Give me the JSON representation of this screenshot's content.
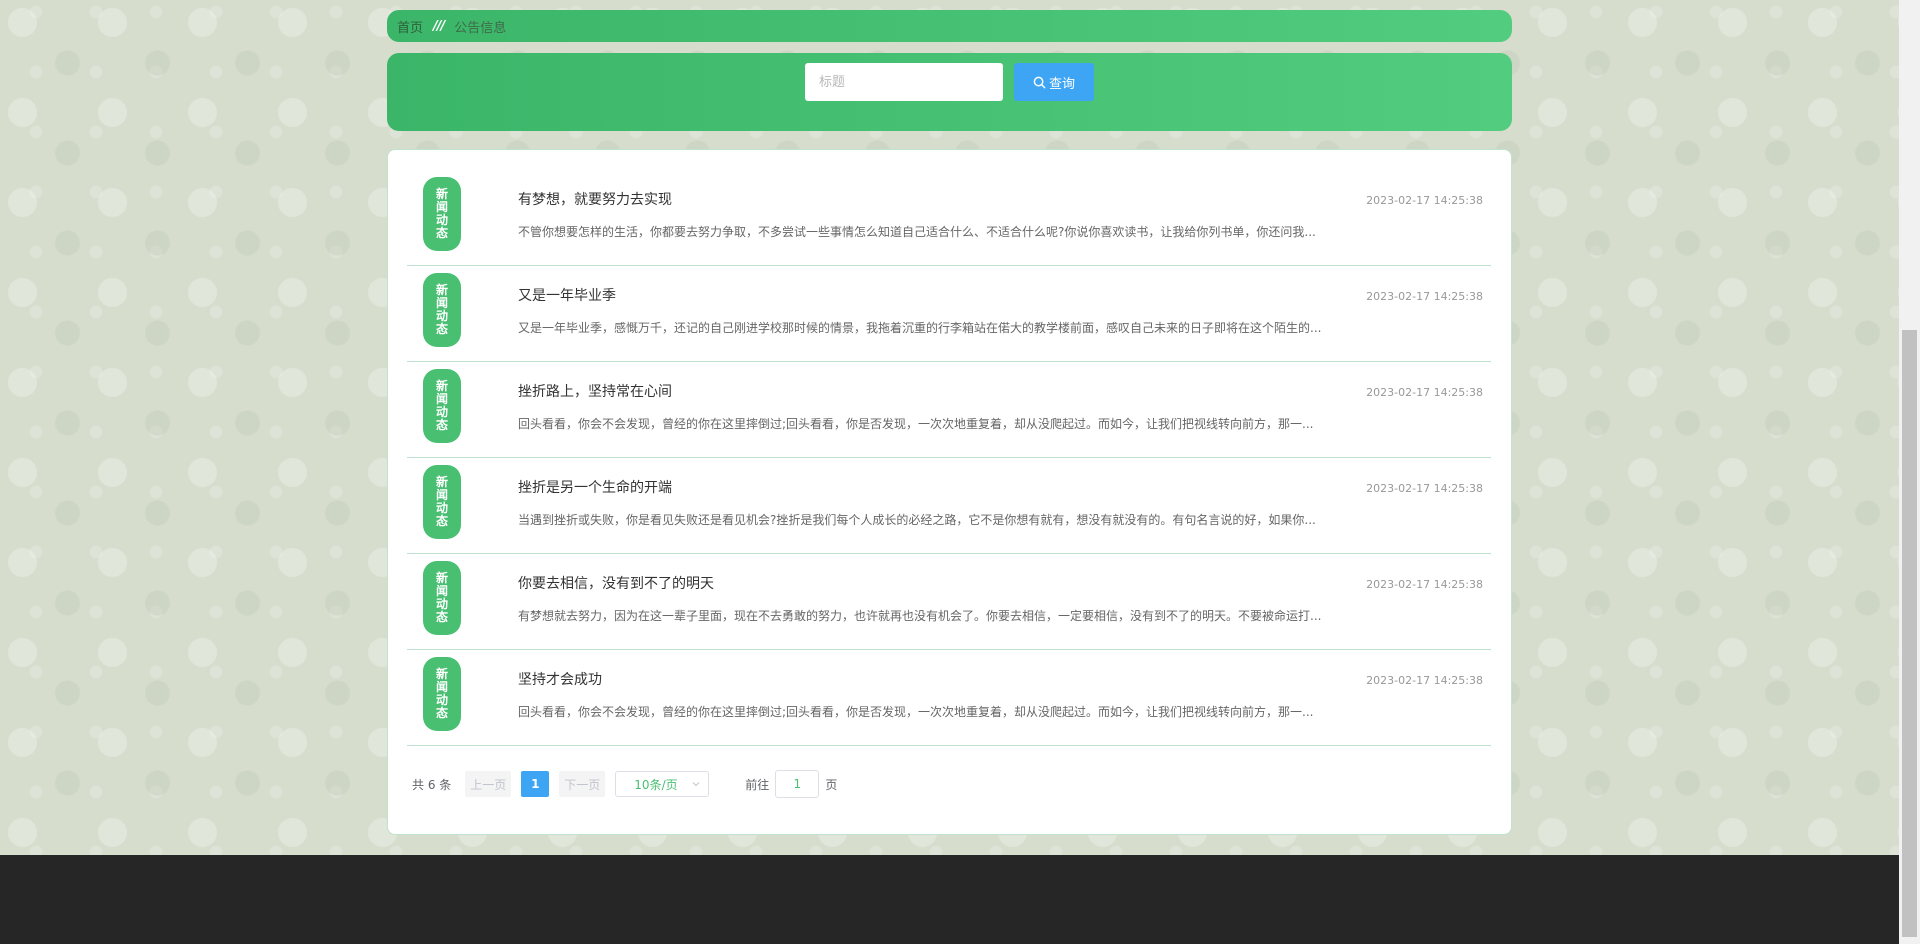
{
  "breadcrumb": {
    "home": "首页",
    "separator": "///",
    "current": "公告信息"
  },
  "search": {
    "placeholder": "标题",
    "value": "",
    "button_label": "查询"
  },
  "news": {
    "badge": "新闻动态",
    "items": [
      {
        "title": "有梦想，就要努力去实现",
        "date": "2023-02-17 14:25:38",
        "summary": "不管你想要怎样的生活，你都要去努力争取，不多尝试一些事情怎么知道自己适合什么、不适合什么呢?你说你喜欢读书，让我给你列书单，你还问我..."
      },
      {
        "title": "又是一年毕业季",
        "date": "2023-02-17 14:25:38",
        "summary": "又是一年毕业季，感慨万千，还记的自己刚进学校那时候的情景，我拖着沉重的行李箱站在偌大的教学楼前面，感叹自己未来的日子即将在这个陌生的..."
      },
      {
        "title": "挫折路上，坚持常在心间",
        "date": "2023-02-17 14:25:38",
        "summary": "回头看看，你会不会发现，曾经的你在这里摔倒过;回头看看，你是否发现，一次次地重复着，却从没爬起过。而如今，让我们把视线转向前方，那一..."
      },
      {
        "title": "挫折是另一个生命的开端",
        "date": "2023-02-17 14:25:38",
        "summary": "当遇到挫折或失败，你是看见失败还是看见机会?挫折是我们每个人成长的必经之路，它不是你想有就有，想没有就没有的。有句名言说的好，如果你..."
      },
      {
        "title": "你要去相信，没有到不了的明天",
        "date": "2023-02-17 14:25:38",
        "summary": "有梦想就去努力，因为在这一辈子里面，现在不去勇敢的努力，也许就再也没有机会了。你要去相信，一定要相信，没有到不了的明天。不要被命运打..."
      },
      {
        "title": "坚持才会成功",
        "date": "2023-02-17 14:25:38",
        "summary": "回头看看，你会不会发现，曾经的你在这里摔倒过;回头看看，你是否发现，一次次地重复着，却从没爬起过。而如今，让我们把视线转向前方，那一..."
      }
    ]
  },
  "pagination": {
    "total": "共 6 条",
    "prev": "上一页",
    "current_page": "1",
    "next": "下一页",
    "page_size": "10条/页",
    "goto_label": "前往",
    "goto_value": "1",
    "goto_suffix": "页"
  },
  "colors": {
    "green_accent": "#49bf72",
    "blue_accent": "#3ea5f5",
    "footer": "#262626"
  }
}
